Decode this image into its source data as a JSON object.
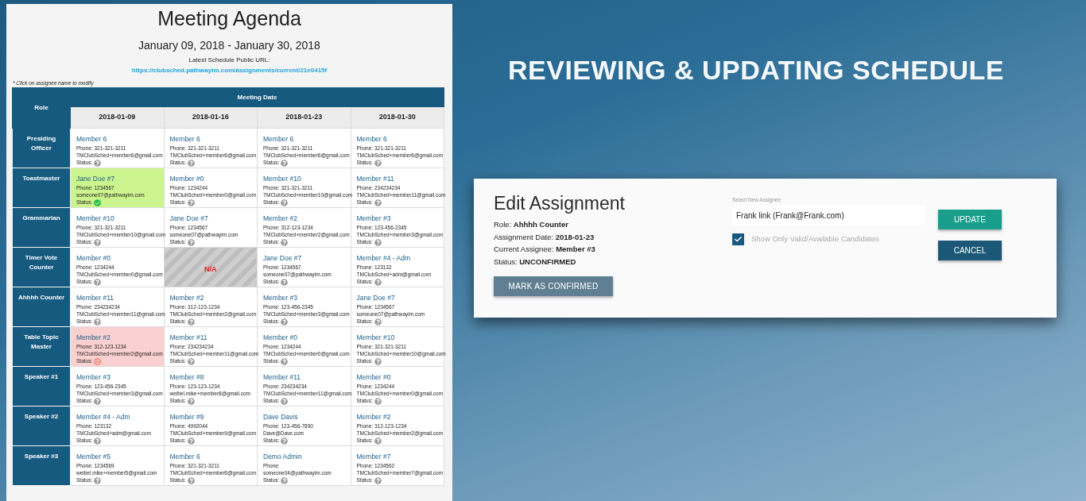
{
  "agenda": {
    "title": "Meeting Agenda",
    "date_range": "January 09, 2018 - January 30, 2018",
    "url_label": "Latest Schedule Public URL:",
    "url": "https://clubsched.pathwayim.com/assignments/current/21e0415f",
    "note": "* Click on assignee name to modify",
    "table": {
      "role_header": "Role",
      "date_header": "Meeting Date",
      "columns": [
        "2018-01-09",
        "2018-01-16",
        "2018-01-23",
        "2018-01-30"
      ],
      "rows": [
        {
          "role": "Presiding Officer",
          "cells": [
            {
              "kind": "pending",
              "name": "Member 6",
              "phone": "Phone: 321-321-3211",
              "email": "TMClubSched+member6@gmail.com",
              "status_label": "Status:"
            },
            {
              "kind": "pending",
              "name": "Member 6",
              "phone": "Phone: 321-321-3211",
              "email": "TMClubSched+member6@gmail.com",
              "status_label": "Status:"
            },
            {
              "kind": "pending",
              "name": "Member 6",
              "phone": "Phone: 321-321-3211",
              "email": "TMClubSched+member6@gmail.com",
              "status_label": "Status:"
            },
            {
              "kind": "pending",
              "name": "Member 6",
              "phone": "Phone: 321-321-3211",
              "email": "TMClubSched+member6@gmail.com",
              "status_label": "Status:"
            }
          ]
        },
        {
          "role": "Toastmaster",
          "cells": [
            {
              "kind": "confirmed",
              "name": "Jane Doe #7",
              "phone": "Phone: 1234567",
              "email": "someone07@pathwayim.com",
              "status_label": "Status:"
            },
            {
              "kind": "pending",
              "name": "Member #0",
              "phone": "Phone: 1234244",
              "email": "TMClubSched+member0@gmail.com",
              "status_label": "Status:"
            },
            {
              "kind": "pending",
              "name": "Member #10",
              "phone": "Phone: 321-321-3211",
              "email": "TMClubSched+member10@gmail.com",
              "status_label": "Status:"
            },
            {
              "kind": "pending",
              "name": "Member #11",
              "phone": "Phone: 234234234",
              "email": "TMClubSched+member11@gmail.com",
              "status_label": "Status:"
            }
          ]
        },
        {
          "role": "Grammarian",
          "cells": [
            {
              "kind": "pending",
              "name": "Member #10",
              "phone": "Phone: 321-321-3211",
              "email": "TMClubSched+member10@gmail.com",
              "status_label": "Status:"
            },
            {
              "kind": "pending",
              "name": "Jane Doe #7",
              "phone": "Phone: 1234567",
              "email": "someone07@pathwayim.com",
              "status_label": "Status:"
            },
            {
              "kind": "pending",
              "name": "Member #2",
              "phone": "Phone: 312-123-1234",
              "email": "TMClubSched+member2@gmail.com",
              "status_label": "Status:"
            },
            {
              "kind": "pending",
              "name": "Member #3",
              "phone": "Phone: 123-456-2345",
              "email": "TMClubSched+member3@gmail.com",
              "status_label": "Status:"
            }
          ]
        },
        {
          "role": "Timer Vote Counter",
          "cells": [
            {
              "kind": "pending",
              "name": "Member #0",
              "phone": "Phone: 1234244",
              "email": "TMClubSched+member0@gmail.com",
              "status_label": "Status:"
            },
            {
              "kind": "na",
              "text": "N/A"
            },
            {
              "kind": "pending",
              "name": "Jane Doe #7",
              "phone": "Phone: 1234567",
              "email": "someone07@pathwayim.com",
              "status_label": "Status:"
            },
            {
              "kind": "pending",
              "name": "Member #4 - Adm",
              "phone": "Phone: 123132",
              "email": "TMClubSched+adm@gmail.com",
              "status_label": "Status:"
            }
          ]
        },
        {
          "role": "Ahhhh Counter",
          "cells": [
            {
              "kind": "pending",
              "name": "Member #11",
              "phone": "Phone: 234234234",
              "email": "TMClubSched+member11@gmail.com",
              "status_label": "Status:"
            },
            {
              "kind": "pending",
              "name": "Member #2",
              "phone": "Phone: 312-123-1234",
              "email": "TMClubSched+member2@gmail.com",
              "status_label": "Status:"
            },
            {
              "kind": "pending",
              "name": "Member #3",
              "phone": "Phone: 123-456-2345",
              "email": "TMClubSched+member3@gmail.com",
              "status_label": "Status:"
            },
            {
              "kind": "pending",
              "name": "Jane Doe #7",
              "phone": "Phone: 1234567",
              "email": "someone07@pathwayim.com",
              "status_label": "Status:"
            }
          ]
        },
        {
          "role": "Table Topic Master",
          "cells": [
            {
              "kind": "declined",
              "name": "Member #2",
              "phone": "Phone: 312-123-1234",
              "email": "TMClubSched+member2@gmail.com",
              "status_label": "Status:"
            },
            {
              "kind": "pending",
              "name": "Member #11",
              "phone": "Phone: 234234234",
              "email": "TMClubSched+member11@gmail.com",
              "status_label": "Status:"
            },
            {
              "kind": "pending",
              "name": "Member #0",
              "phone": "Phone: 1234244",
              "email": "TMClubSched+member0@gmail.com",
              "status_label": "Status:"
            },
            {
              "kind": "pending",
              "name": "Member #10",
              "phone": "Phone: 321-321-3211",
              "email": "TMClubSched+member10@gmail.com",
              "status_label": "Status:"
            }
          ]
        },
        {
          "role": "Speaker #1",
          "cells": [
            {
              "kind": "pending",
              "name": "Member #3",
              "phone": "Phone: 123-456-2345",
              "email": "TMClubSched+member3@gmail.com",
              "status_label": "Status:"
            },
            {
              "kind": "pending",
              "name": "Member #8",
              "phone": "Phone: 123-123-1234",
              "email": "weibel.mike+member8@gmail.com",
              "status_label": "Status:"
            },
            {
              "kind": "pending",
              "name": "Member #11",
              "phone": "Phone: 234234234",
              "email": "TMClubSched+member11@gmail.com",
              "status_label": "Status:"
            },
            {
              "kind": "pending",
              "name": "Member #0",
              "phone": "Phone: 1234244",
              "email": "TMClubSched+member0@gmail.com",
              "status_label": "Status:"
            }
          ]
        },
        {
          "role": "Speaker #2",
          "cells": [
            {
              "kind": "pending",
              "name": "Member #4 - Adm",
              "phone": "Phone: 123132",
              "email": "TMClubSched+adm@gmail.com",
              "status_label": "Status:"
            },
            {
              "kind": "pending",
              "name": "Member #9",
              "phone": "Phone: 4992044",
              "email": "TMClubSched+member9@gmail.com",
              "status_label": "Status:"
            },
            {
              "kind": "pending",
              "name": "Dave Davis",
              "phone": "Phone: 123-456-7890",
              "email": "Dave@Dave.com",
              "status_label": "Status:"
            },
            {
              "kind": "pending",
              "name": "Member #2",
              "phone": "Phone: 312-123-1234",
              "email": "TMClubSched+member2@gmail.com",
              "status_label": "Status:"
            }
          ]
        },
        {
          "role": "Speaker #3",
          "cells": [
            {
              "kind": "pending",
              "name": "Member #5",
              "phone": "Phone: 1234569",
              "email": "weibel.mike+member5@gmail.com",
              "status_label": "Status:"
            },
            {
              "kind": "pending",
              "name": "Member 6",
              "phone": "Phone: 321-321-3211",
              "email": "TMClubSched+member6@gmail.com",
              "status_label": "Status:"
            },
            {
              "kind": "pending",
              "name": "Demo Admin",
              "phone": "Phone:",
              "email": "someone04@pathwayim.com",
              "status_label": "Status:"
            },
            {
              "kind": "pending",
              "name": "Member #7",
              "phone": "Phone: 1234562",
              "email": "TMClubSched+member7@gmail.com",
              "status_label": "Status:"
            }
          ]
        }
      ]
    }
  },
  "headline": "REVIEWING & UPDATING SCHEDULE",
  "dialog": {
    "title": "Edit Assignment",
    "details": [
      "Role: **Ahhhh Counter**",
      "Assignment Date: **2018-01-23**",
      "Current Assignee: **Member #3**",
      "Status: **UNCONFIRMED**"
    ],
    "confirm_button": "MARK AS CONFIRMED",
    "assignee_field": {
      "label": "Select New Assignee",
      "value": "Frank link (Frank@Frank.com)"
    },
    "filter_checkbox": {
      "label": "Show Only Valid/Available Candidates",
      "checked": true
    },
    "update_button": "UPDATE",
    "cancel_button": "CANCEL"
  }
}
